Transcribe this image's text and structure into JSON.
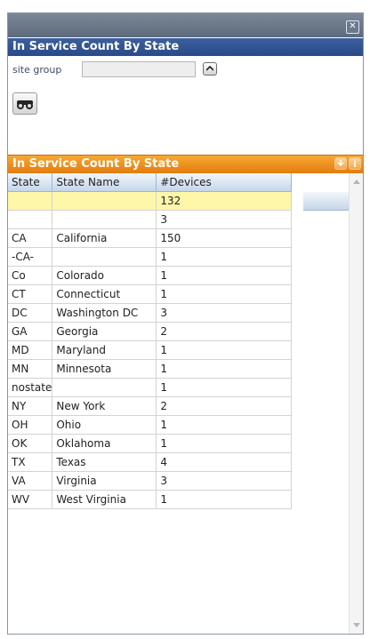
{
  "window": {
    "close_icon": "✕"
  },
  "filter_panel": {
    "title": "In Service Count By State",
    "site_group_label": "site group",
    "site_group_value": "",
    "toggle_icon": "chevron-up-icon",
    "search_icon": "binoculars-icon"
  },
  "results_panel": {
    "title": "In Service Count By State",
    "header_icons": [
      "download-icon",
      "info-icon"
    ],
    "columns": [
      "State",
      "State Name",
      "#Devices"
    ],
    "rows": [
      [
        "",
        "",
        "132"
      ],
      [
        "",
        "",
        "3"
      ],
      [
        "CA",
        "California",
        "150"
      ],
      [
        "-CA-",
        "",
        "1"
      ],
      [
        "Co",
        "Colorado",
        "1"
      ],
      [
        "CT",
        "Connecticut",
        "1"
      ],
      [
        "DC",
        "Washington DC",
        "3"
      ],
      [
        "GA",
        "Georgia",
        "2"
      ],
      [
        "MD",
        "Maryland",
        "1"
      ],
      [
        "MN",
        "Minnesota",
        "1"
      ],
      [
        "nostate",
        "",
        "1"
      ],
      [
        "NY",
        "New York",
        "2"
      ],
      [
        "OH",
        "Ohio",
        "1"
      ],
      [
        "OK",
        "Oklahoma",
        "1"
      ],
      [
        "TX",
        "Texas",
        "4"
      ],
      [
        "VA",
        "Virginia",
        "3"
      ],
      [
        "WV",
        "West Virginia",
        "1"
      ]
    ],
    "selected_row": 0
  },
  "colors": {
    "title_bar": "#5c6a7b",
    "filter_header": "#284a88",
    "results_header": "#f08c1a",
    "selected_row": "#fef6a8",
    "grid_header": "#c5d6ea"
  }
}
